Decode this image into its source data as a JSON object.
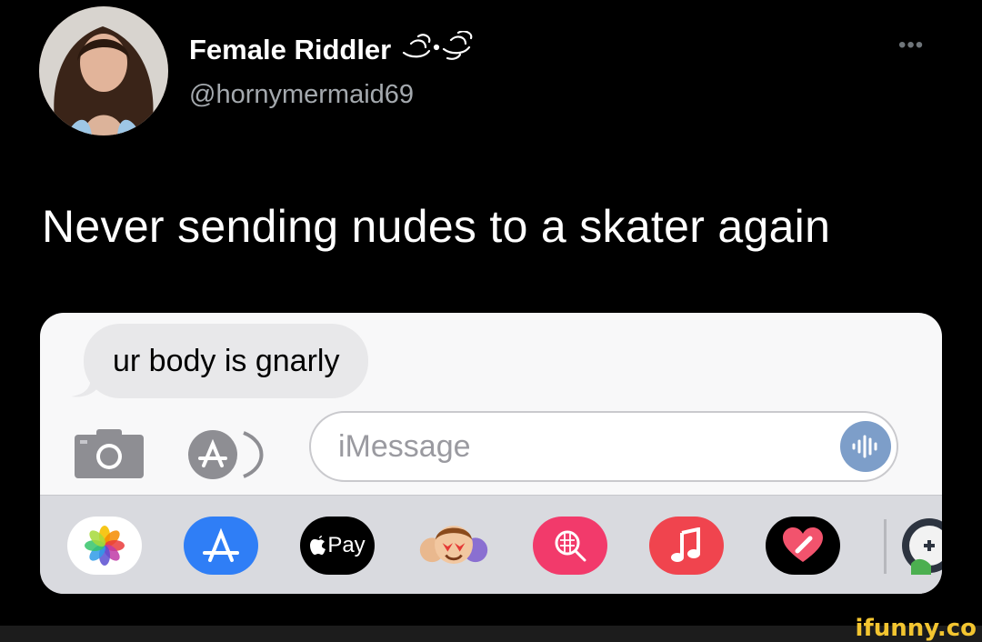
{
  "tweet": {
    "display_name": "Female Riddler",
    "handle": "@hornymermaid69",
    "more_label": "•••",
    "text": "Never sending nudes to a skater again"
  },
  "imessage": {
    "received_message": "ur body is gnarly",
    "input_placeholder": "iMessage",
    "tray": {
      "apple_pay_label": "Pay"
    }
  },
  "watermark": "ifunny.co",
  "icons": [
    "photo-avatar",
    "decorative-flourish-icon",
    "more-icon",
    "camera-icon",
    "app-store-icon",
    "audio-waveform-icon",
    "photos-app-icon",
    "app-store-app-icon",
    "apple-pay-icon",
    "memoji-icon",
    "search-images-icon",
    "music-app-icon",
    "digital-touch-icon",
    "game-app-icon"
  ],
  "colors": {
    "background": "#000000",
    "handle_gray": "#a4a9ae",
    "bubble_gray": "#e8e8ea",
    "app_store_blue": "#2f7ef6",
    "search_pink": "#f23a6b",
    "music_red": "#f0444e",
    "watermark_yellow": "#f3c530"
  }
}
